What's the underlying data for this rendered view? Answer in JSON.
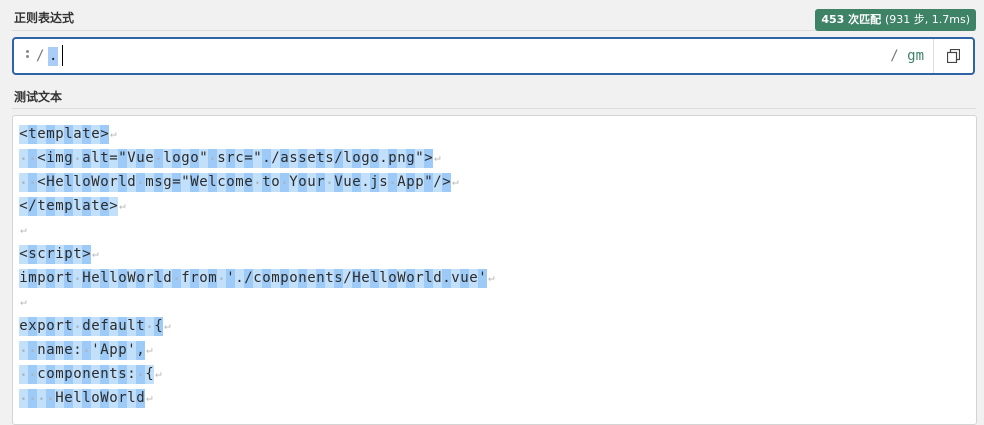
{
  "regex_section": {
    "label": "正则表达式",
    "match_badge": {
      "count": "453 次匹配",
      "detail": "(931 步, 1.7ms)"
    },
    "delimiter_open": "/",
    "pattern": ".",
    "delimiter_close": "/",
    "flags": "gm",
    "copy_icon": "copy-icon"
  },
  "test_section": {
    "label": "测试文本",
    "lines": [
      "<template>",
      "  <img alt=\"Vue logo\" src=\"./assets/logo.png\">",
      "  <HelloWorld msg=\"Welcome to Your Vue.js App\"/>",
      "</template>",
      "",
      "<script>",
      "import HelloWorld from './components/HelloWorld.vue'",
      "",
      "export default {",
      "  name: 'App',",
      "  components: {",
      "    HelloWorld"
    ],
    "newline_glyph": "↵"
  },
  "colors": {
    "accent": "#2f63a8",
    "badge": "#3f8367",
    "match_a": "#c3e0fb",
    "match_b": "#9dcaf6"
  }
}
